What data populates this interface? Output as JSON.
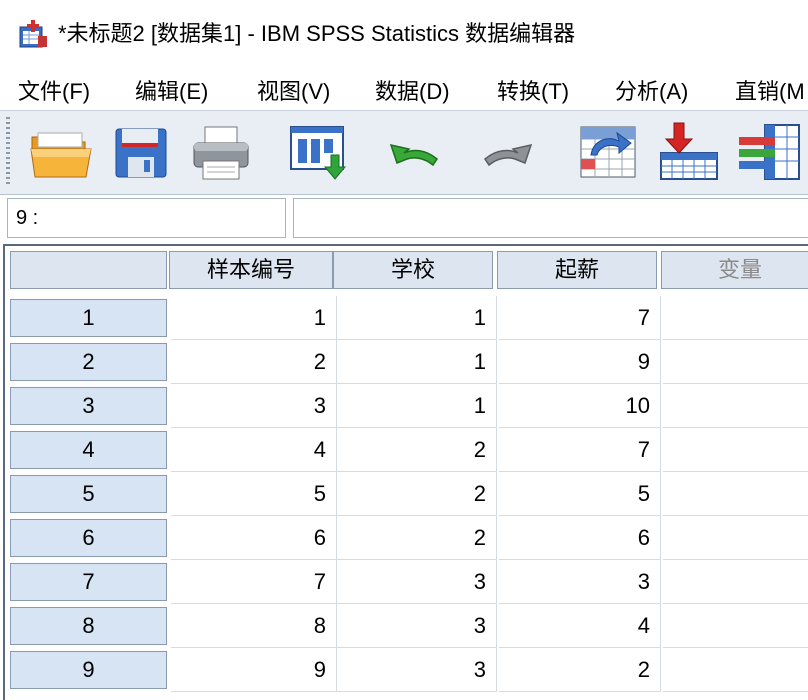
{
  "window": {
    "title": "*未标题2 [数据集1] - IBM SPSS Statistics 数据编辑器",
    "icon": "spss-app-icon"
  },
  "menu": {
    "items": [
      {
        "label": "文件(F)",
        "name": "menu-file"
      },
      {
        "label": "编辑(E)",
        "name": "menu-edit"
      },
      {
        "label": "视图(V)",
        "name": "menu-view"
      },
      {
        "label": "数据(D)",
        "name": "menu-data"
      },
      {
        "label": "转换(T)",
        "name": "menu-transform"
      },
      {
        "label": "分析(A)",
        "name": "menu-analyze"
      },
      {
        "label": "直销(M",
        "name": "menu-direct-marketing"
      }
    ]
  },
  "toolbar": {
    "buttons": [
      {
        "icon": "open-folder-icon"
      },
      {
        "icon": "save-icon"
      },
      {
        "icon": "print-icon"
      },
      {
        "icon": "recall-dialog-icon"
      },
      {
        "icon": "undo-icon"
      },
      {
        "icon": "redo-icon"
      },
      {
        "icon": "goto-case-icon"
      },
      {
        "icon": "insert-cases-icon"
      },
      {
        "icon": "variables-icon"
      }
    ]
  },
  "cell_editor": {
    "ref": "9 :",
    "value": ""
  },
  "grid": {
    "columns": [
      {
        "label": "样本编号",
        "dim": false
      },
      {
        "label": "学校",
        "dim": false
      },
      {
        "label": "起薪",
        "dim": false
      },
      {
        "label": "变量",
        "dim": true
      }
    ],
    "rows": [
      {
        "num": "1",
        "cells": [
          "1",
          "1",
          "7",
          ""
        ]
      },
      {
        "num": "2",
        "cells": [
          "2",
          "1",
          "9",
          ""
        ]
      },
      {
        "num": "3",
        "cells": [
          "3",
          "1",
          "10",
          ""
        ]
      },
      {
        "num": "4",
        "cells": [
          "4",
          "2",
          "7",
          ""
        ]
      },
      {
        "num": "5",
        "cells": [
          "5",
          "2",
          "5",
          ""
        ]
      },
      {
        "num": "6",
        "cells": [
          "6",
          "2",
          "6",
          ""
        ]
      },
      {
        "num": "7",
        "cells": [
          "7",
          "3",
          "3",
          ""
        ]
      },
      {
        "num": "8",
        "cells": [
          "8",
          "3",
          "4",
          ""
        ]
      },
      {
        "num": "9",
        "cells": [
          "9",
          "3",
          "2",
          ""
        ]
      }
    ]
  },
  "colors": {
    "header_bg": "#dde6f0",
    "row_header_bg": "#d6e4f4",
    "toolbar_bg": "#e9eef4"
  }
}
